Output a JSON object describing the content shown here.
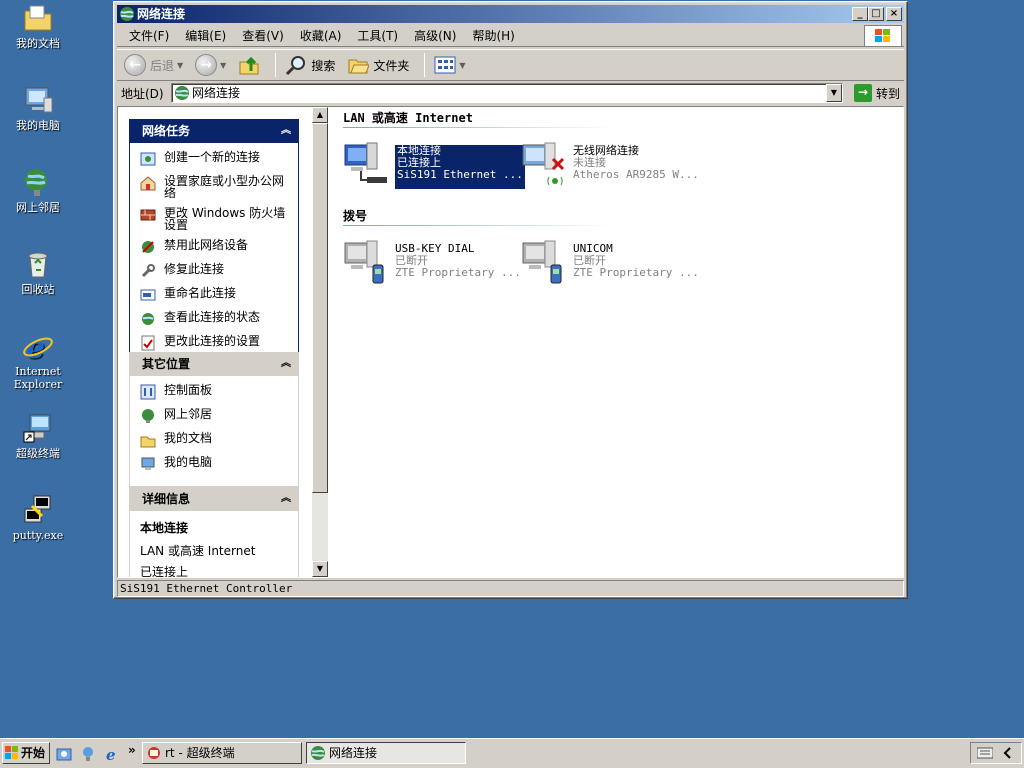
{
  "desktop": {
    "icons": [
      {
        "label": "我的文档"
      },
      {
        "label": "我的电脑"
      },
      {
        "label": "网上邻居"
      },
      {
        "label": "回收站"
      },
      {
        "label": "Internet Explorer"
      },
      {
        "label": "超级终端"
      },
      {
        "label": "putty.exe"
      }
    ]
  },
  "window": {
    "title": "网络连接",
    "controls": {
      "minimize": "_",
      "maximize": "□",
      "close": "×"
    }
  },
  "menubar": {
    "items": [
      "文件(F)",
      "编辑(E)",
      "查看(V)",
      "收藏(A)",
      "工具(T)",
      "高级(N)",
      "帮助(H)"
    ]
  },
  "toolbar": {
    "back": "后退",
    "search": "搜索",
    "folders": "文件夹"
  },
  "addressbar": {
    "label": "地址(D)",
    "value": "网络连接",
    "go": "转到"
  },
  "taskpane": {
    "network_tasks": {
      "title": "网络任务",
      "items": [
        "创建一个新的连接",
        "设置家庭或小型办公网络",
        "更改 Windows 防火墙设置",
        "禁用此网络设备",
        "修复此连接",
        "重命名此连接",
        "查看此连接的状态",
        "更改此连接的设置"
      ]
    },
    "other_places": {
      "title": "其它位置",
      "items": [
        "控制面板",
        "网上邻居",
        "我的文档",
        "我的电脑"
      ]
    },
    "details": {
      "title": "详细信息",
      "name": "本地连接",
      "type": "LAN 或高速 Internet",
      "status": "已连接上"
    }
  },
  "main": {
    "groups": [
      {
        "title": "LAN 或高速 Internet",
        "connections": [
          {
            "name": "本地连接",
            "status": "已连接上",
            "device": "SiS191 Ethernet ...",
            "selected": true
          },
          {
            "name": "无线网络连接",
            "status": "未连接",
            "device": "Atheros AR9285 W...",
            "selected": false
          }
        ]
      },
      {
        "title": "拨号",
        "connections": [
          {
            "name": "USB-KEY DIAL",
            "status": "已断开",
            "device": "ZTE Proprietary ...",
            "selected": false
          },
          {
            "name": "UNICOM",
            "status": "已断开",
            "device": "ZTE Proprietary ...",
            "selected": false
          }
        ]
      }
    ]
  },
  "statusbar": {
    "text": "SiS191 Ethernet Controller"
  },
  "taskbar": {
    "start": "开始",
    "more": "»",
    "buttons": [
      "rt - 超级终端",
      "网络连接"
    ]
  },
  "colors": {
    "desktop": "#3a6ea5",
    "title_active": "#0a246a",
    "face": "#d4d0c8",
    "selection": "#0a246a"
  }
}
